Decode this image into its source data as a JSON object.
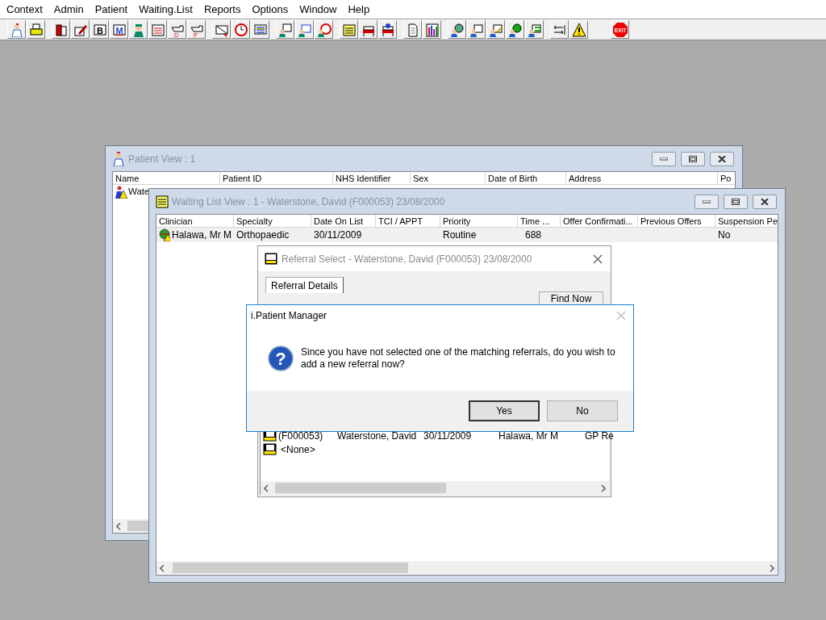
{
  "menu": [
    "Context",
    "Admin",
    "Patient",
    "Waiting.List",
    "Reports",
    "Options",
    "Window",
    "Help"
  ],
  "toolbar": [
    [
      {
        "kind": "doctor"
      },
      {
        "kind": "printer"
      }
    ],
    [
      {
        "kind": "book"
      },
      {
        "kind": "pen"
      },
      {
        "kind": "card",
        "glyph": "B"
      },
      {
        "kind": "letter",
        "glyph": "M"
      },
      {
        "kind": "nurse"
      },
      {
        "kind": "note"
      },
      {
        "kind": "hand",
        "glyph": "D"
      },
      {
        "kind": "hand",
        "glyph": "P"
      }
    ],
    [
      {
        "kind": "envelope"
      },
      {
        "kind": "clock"
      },
      {
        "kind": "monitor"
      }
    ],
    [
      {
        "kind": "person-screen"
      },
      {
        "kind": "person-form"
      },
      {
        "kind": "person-clock"
      }
    ],
    [
      {
        "kind": "sticky"
      },
      {
        "kind": "bed"
      },
      {
        "kind": "bed-person"
      }
    ],
    [
      {
        "kind": "document"
      },
      {
        "kind": "bars"
      }
    ],
    [
      {
        "kind": "globe-person"
      },
      {
        "kind": "form-person"
      },
      {
        "kind": "edit-person"
      },
      {
        "kind": "globe2-person"
      },
      {
        "kind": "arrows-person"
      }
    ],
    [
      {
        "kind": "split"
      },
      {
        "kind": "warning"
      }
    ],
    [
      {
        "kind": "exit",
        "glyph": "EXIT"
      }
    ]
  ],
  "patient_view": {
    "title": "Patient View : 1",
    "columns": [
      "Name",
      "Patient ID",
      "NHS Identifier",
      "Sex",
      "Date of Birth",
      "Address",
      "Po"
    ],
    "rows": [
      {
        "name": "Wate"
      }
    ]
  },
  "waiting_list_view": {
    "title": "Waiting List View :  1 - Waterstone, David (F000053) 23/08/2000",
    "columns": [
      "Clinician",
      "Specialty",
      "Date On List",
      "TCI / APPT",
      "Priority",
      "Time ...",
      "Offer Confirmati...",
      "Previous Offers",
      "Suspension Pe"
    ],
    "rows": [
      {
        "selected": true,
        "cells": [
          "Halawa, Mr M",
          "Orthopaedic",
          "30/11/2009",
          "",
          "Routine",
          "688",
          "",
          "",
          "No"
        ]
      }
    ]
  },
  "referral_select": {
    "title": "Referral Select - Waterstone, David (F000053) 23/08/2000",
    "tabs": [
      {
        "label": "Referral Details",
        "selected": true
      }
    ],
    "find_button": "Find Now",
    "rows": [
      [
        "(F000053)",
        "Waterstone, David",
        "30/11/2009",
        "Halawa, Mr M",
        "GP Re"
      ],
      [
        "<None>"
      ]
    ]
  },
  "dialog": {
    "title": "i.Patient Manager",
    "icon_glyph": "?",
    "message": "Since you have not selected one of the matching referrals, do you wish to add a new referral now?",
    "buttons": [
      {
        "label": "Yes",
        "default": true
      },
      {
        "label": "No",
        "default": false
      }
    ]
  }
}
